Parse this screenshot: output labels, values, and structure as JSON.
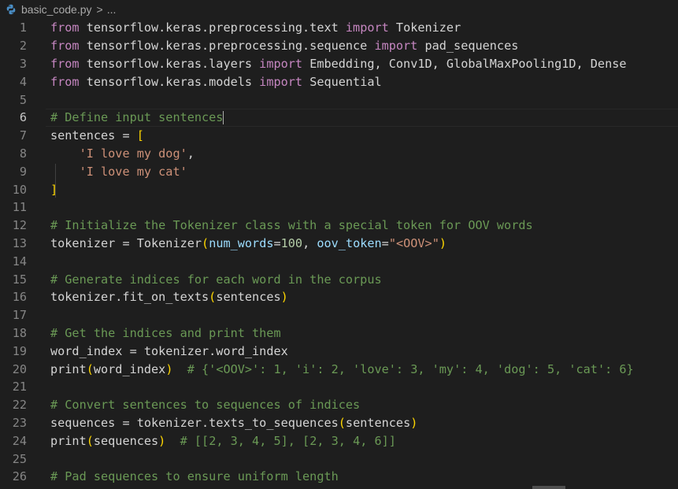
{
  "breadcrumb": {
    "file_name": "basic_code.py",
    "separator": ">",
    "ellipsis": "...",
    "file_icon": "python-icon"
  },
  "editor": {
    "current_line": 6,
    "lines": [
      {
        "n": "1",
        "tokens": [
          {
            "t": "from",
            "c": "kw-import"
          },
          {
            "t": " tensorflow.keras.preprocessing.text ",
            "c": "ident"
          },
          {
            "t": "import",
            "c": "kw-import"
          },
          {
            "t": " Tokenizer",
            "c": "ident"
          }
        ]
      },
      {
        "n": "2",
        "tokens": [
          {
            "t": "from",
            "c": "kw-import"
          },
          {
            "t": " tensorflow.keras.preprocessing.sequence ",
            "c": "ident"
          },
          {
            "t": "import",
            "c": "kw-import"
          },
          {
            "t": " pad_sequences",
            "c": "ident"
          }
        ]
      },
      {
        "n": "3",
        "tokens": [
          {
            "t": "from",
            "c": "kw-import"
          },
          {
            "t": " tensorflow.keras.layers ",
            "c": "ident"
          },
          {
            "t": "import",
            "c": "kw-import"
          },
          {
            "t": " Embedding, Conv1D, GlobalMaxPooling1D, Dense",
            "c": "ident"
          }
        ]
      },
      {
        "n": "4",
        "tokens": [
          {
            "t": "from",
            "c": "kw-import"
          },
          {
            "t": " tensorflow.keras.models ",
            "c": "ident"
          },
          {
            "t": "import",
            "c": "kw-import"
          },
          {
            "t": " Sequential",
            "c": "ident"
          }
        ]
      },
      {
        "n": "5",
        "tokens": []
      },
      {
        "n": "6",
        "tokens": [
          {
            "t": "# Define input sentences",
            "c": "cmt"
          }
        ],
        "cursor": true
      },
      {
        "n": "7",
        "tokens": [
          {
            "t": "sentences",
            "c": "ident"
          },
          {
            "t": " = ",
            "c": "op"
          },
          {
            "t": "[",
            "c": "br1"
          }
        ]
      },
      {
        "n": "8",
        "tokens": [
          {
            "t": "    ",
            "c": "ident"
          },
          {
            "t": "'I love my dog'",
            "c": "str"
          },
          {
            "t": ",",
            "c": "op"
          }
        ]
      },
      {
        "n": "9",
        "tokens": [
          {
            "t": "    ",
            "c": "ident"
          },
          {
            "t": "'I love my cat'",
            "c": "str"
          }
        ]
      },
      {
        "n": "10",
        "tokens": [
          {
            "t": "]",
            "c": "br1"
          }
        ]
      },
      {
        "n": "11",
        "tokens": []
      },
      {
        "n": "12",
        "tokens": [
          {
            "t": "# Initialize the Tokenizer class with a special token for OOV words",
            "c": "cmt"
          }
        ]
      },
      {
        "n": "13",
        "tokens": [
          {
            "t": "tokenizer",
            "c": "ident"
          },
          {
            "t": " = ",
            "c": "op"
          },
          {
            "t": "Tokenizer",
            "c": "ident"
          },
          {
            "t": "(",
            "c": "br1"
          },
          {
            "t": "num_words",
            "c": "var"
          },
          {
            "t": "=",
            "c": "op"
          },
          {
            "t": "100",
            "c": "num"
          },
          {
            "t": ", ",
            "c": "op"
          },
          {
            "t": "oov_token",
            "c": "var"
          },
          {
            "t": "=",
            "c": "op"
          },
          {
            "t": "\"<OOV>\"",
            "c": "str"
          },
          {
            "t": ")",
            "c": "br1"
          }
        ]
      },
      {
        "n": "14",
        "tokens": []
      },
      {
        "n": "15",
        "tokens": [
          {
            "t": "# Generate indices for each word in the corpus",
            "c": "cmt"
          }
        ]
      },
      {
        "n": "16",
        "tokens": [
          {
            "t": "tokenizer.fit_on_texts",
            "c": "ident"
          },
          {
            "t": "(",
            "c": "br1"
          },
          {
            "t": "sentences",
            "c": "ident"
          },
          {
            "t": ")",
            "c": "br1"
          }
        ]
      },
      {
        "n": "17",
        "tokens": []
      },
      {
        "n": "18",
        "tokens": [
          {
            "t": "# Get the indices and print them",
            "c": "cmt"
          }
        ]
      },
      {
        "n": "19",
        "tokens": [
          {
            "t": "word_index",
            "c": "ident"
          },
          {
            "t": " = ",
            "c": "op"
          },
          {
            "t": "tokenizer.word_index",
            "c": "ident"
          }
        ]
      },
      {
        "n": "20",
        "tokens": [
          {
            "t": "print",
            "c": "ident"
          },
          {
            "t": "(",
            "c": "br1"
          },
          {
            "t": "word_index",
            "c": "ident"
          },
          {
            "t": ")",
            "c": "br1"
          },
          {
            "t": "  # {'<OOV>': 1, 'i': 2, 'love': 3, 'my': 4, 'dog': 5, 'cat': 6}",
            "c": "cmt"
          }
        ]
      },
      {
        "n": "21",
        "tokens": []
      },
      {
        "n": "22",
        "tokens": [
          {
            "t": "# Convert sentences to sequences of indices",
            "c": "cmt"
          }
        ]
      },
      {
        "n": "23",
        "tokens": [
          {
            "t": "sequences",
            "c": "ident"
          },
          {
            "t": " = ",
            "c": "op"
          },
          {
            "t": "tokenizer.texts_to_sequences",
            "c": "ident"
          },
          {
            "t": "(",
            "c": "br1"
          },
          {
            "t": "sentences",
            "c": "ident"
          },
          {
            "t": ")",
            "c": "br1"
          }
        ]
      },
      {
        "n": "24",
        "tokens": [
          {
            "t": "print",
            "c": "ident"
          },
          {
            "t": "(",
            "c": "br1"
          },
          {
            "t": "sequences",
            "c": "ident"
          },
          {
            "t": ")",
            "c": "br1"
          },
          {
            "t": "  # [[2, 3, 4, 5], [2, 3, 4, 6]]",
            "c": "cmt"
          }
        ]
      },
      {
        "n": "25",
        "tokens": []
      },
      {
        "n": "26",
        "tokens": [
          {
            "t": "# Pad sequences to ensure uniform length",
            "c": "cmt"
          }
        ]
      }
    ]
  },
  "colors": {
    "background": "#1e1e1e",
    "keyword_import": "#c586c0",
    "identifier": "#d4d4d4",
    "string": "#ce9178",
    "number": "#b5cea8",
    "comment": "#6a9955",
    "bracket": "#ffd700",
    "line_number": "#858585"
  }
}
